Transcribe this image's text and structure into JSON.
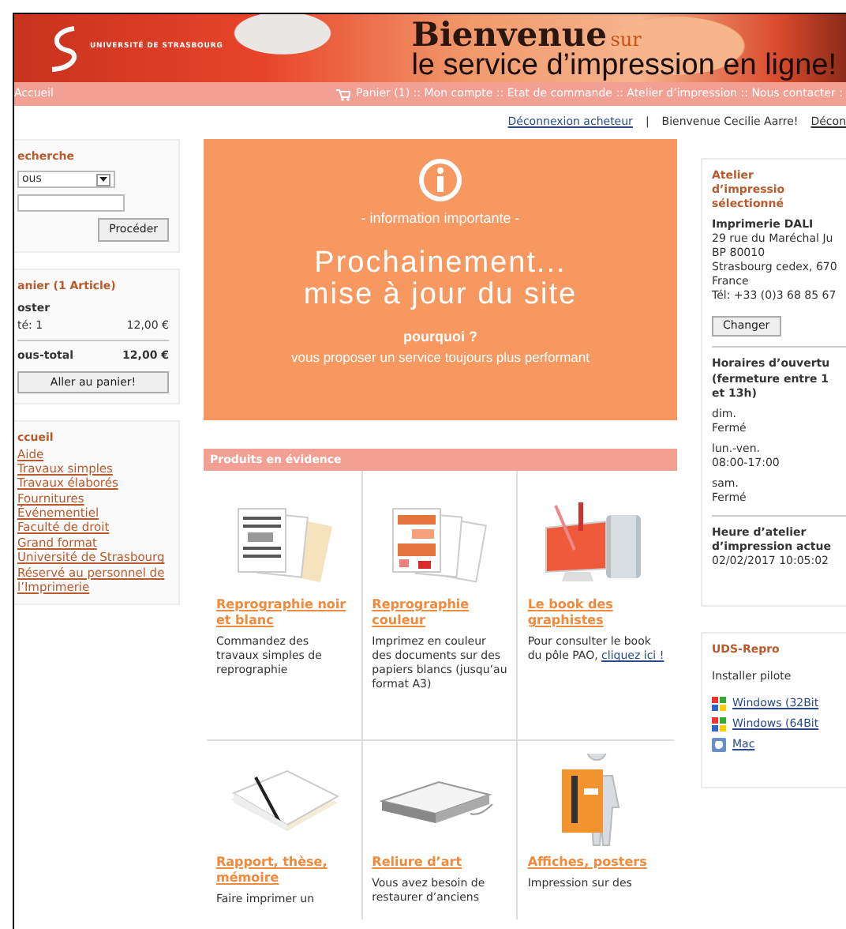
{
  "header": {
    "logo_text": "UNIVERSITÉ DE STRASBOURG",
    "title": "Bienvenue",
    "title_small": "sur",
    "subtitle": "le service d’impression en ligne!"
  },
  "nav": {
    "home": "Accueil",
    "links": "Panier (1) :: Mon compte :: Etat de commande :: Atelier d’impression :: Nous contacter :"
  },
  "userbar": {
    "logout": "Déconnexion acheteur",
    "separator": "|",
    "welcome": "Bienvenue Cecilie Aarre!",
    "logout_2": "Décon"
  },
  "search": {
    "title": "echerche",
    "select_value": "ous",
    "button": "Procéder"
  },
  "cart": {
    "title": "anier (1 Article)",
    "item": "oster",
    "qty": "té: 1",
    "qty_price": "12,00 €",
    "subtotal_label": "ous-total",
    "subtotal_value": "12,00 €",
    "button": "Aller au panier!"
  },
  "menu": {
    "title": "ccueil",
    "items": [
      "Aide",
      "Travaux simples",
      "Travaux élaborés",
      "Fournitures",
      "Événementiel",
      "Faculté de droit",
      "Grand format",
      "Université de Strasbourg",
      "Réservé au personnel de l’Imprimerie"
    ]
  },
  "notice": {
    "label": "- information importante -",
    "headline": [
      "Prochainement...",
      "mise à jour du site"
    ],
    "why": "pourquoi ?",
    "reason": "vous proposer un service toujours plus performant"
  },
  "products": {
    "title": "Produits en évidence",
    "items": [
      {
        "kind": "bw-docs",
        "title": "Reprographie noir et blanc",
        "description": "Commandez des travaux simples de reprographie"
      },
      {
        "kind": "color-docs",
        "title": "Reprographie couleur",
        "description": "Imprimez en couleur des documents sur des papiers blancs (jusqu’au format A3)"
      },
      {
        "kind": "computer",
        "title": "Le book des graphistes",
        "description": "Pour consulter le book du pôle PAO,",
        "link": "cliquez ici !"
      },
      {
        "kind": "report",
        "title": "Rapport, thèse, mémoire",
        "description": "Faire imprimer un"
      },
      {
        "kind": "binding",
        "title": "Reliure d’art",
        "description": "Vous avez besoin de restaurer d’anciens"
      },
      {
        "kind": "poster",
        "title": "Affiches, posters",
        "description": "Impression sur des"
      }
    ]
  },
  "workshop": {
    "title": "Atelier d’impressio sélectionné",
    "name": "Imprimerie DALI",
    "address": [
      "29 rue du Maréchal Ju",
      "BP 80010",
      "Strasbourg cedex, 670",
      "France",
      "Tél: +33 (0)3 68 85 67"
    ],
    "button": "Changer"
  },
  "hours": {
    "title": "Horaires d’ouvertu (fermeture entre 1 et 13h)",
    "days": [
      {
        "day": "dim.",
        "hours": "Fermé"
      },
      {
        "day": "lun.-ven.",
        "hours": "08:00-17:00"
      },
      {
        "day": "sam.",
        "hours": "Fermé"
      }
    ]
  },
  "clock": {
    "title": "Heure d’atelier d’impression actue",
    "value": "02/02/2017 10:05:02"
  },
  "repro": {
    "title": "UDS-Repro",
    "install": "Installer pilote",
    "drivers": [
      {
        "kind": "windows",
        "label": "Windows (32Bit"
      },
      {
        "kind": "windows",
        "label": "Windows (64Bit"
      },
      {
        "kind": "mac",
        "label": "Mac"
      }
    ]
  }
}
